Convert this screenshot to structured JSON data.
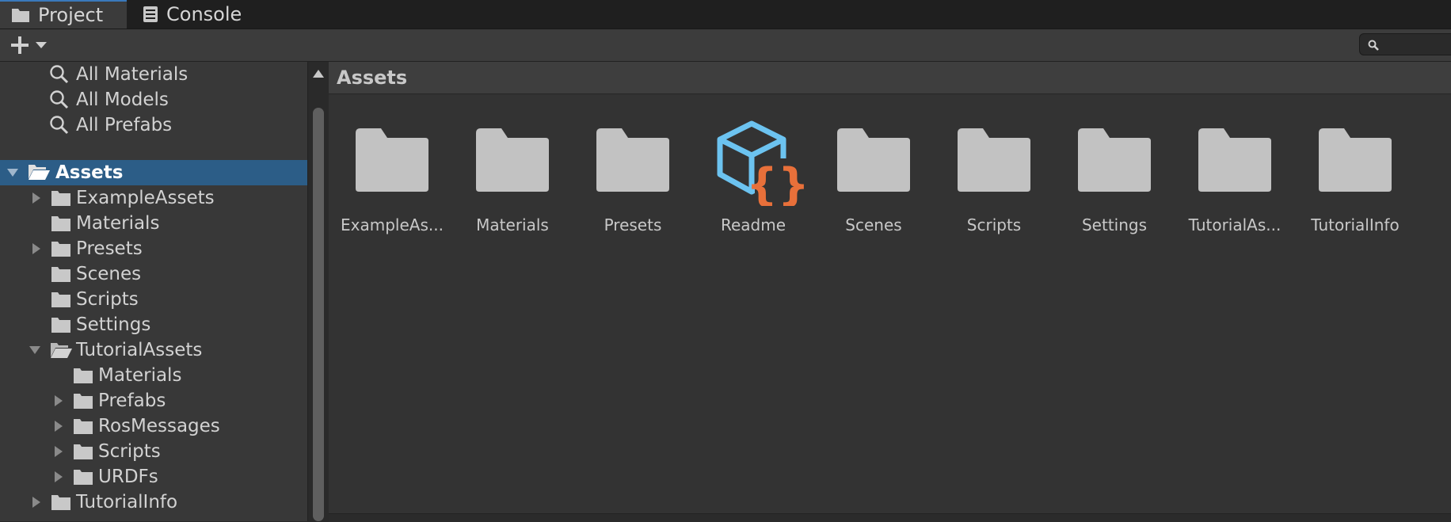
{
  "tabs": [
    {
      "label": "Project",
      "icon": "folder-icon",
      "active": true
    },
    {
      "label": "Console",
      "icon": "console-icon",
      "active": false
    }
  ],
  "toolbar": {
    "add_icon": "plus-icon",
    "dropdown_icon": "chevron-down-icon",
    "search_placeholder": ""
  },
  "sidebar": {
    "items": [
      {
        "label": "All Materials",
        "type": "search-filter",
        "indent": 1
      },
      {
        "label": "All Models",
        "type": "search-filter",
        "indent": 1
      },
      {
        "label": "All Prefabs",
        "type": "search-filter",
        "indent": 1
      },
      {
        "label": "Assets",
        "type": "folder-open",
        "indent": 0,
        "expanded": true,
        "selected": true
      },
      {
        "label": "ExampleAssets",
        "type": "folder",
        "indent": 1,
        "collapsed": true
      },
      {
        "label": "Materials",
        "type": "folder",
        "indent": 1
      },
      {
        "label": "Presets",
        "type": "folder",
        "indent": 1,
        "collapsed": true
      },
      {
        "label": "Scenes",
        "type": "folder",
        "indent": 1
      },
      {
        "label": "Scripts",
        "type": "folder",
        "indent": 1
      },
      {
        "label": "Settings",
        "type": "folder",
        "indent": 1
      },
      {
        "label": "TutorialAssets",
        "type": "folder-open",
        "indent": 1,
        "expanded": true
      },
      {
        "label": "Materials",
        "type": "folder",
        "indent": 2
      },
      {
        "label": "Prefabs",
        "type": "folder",
        "indent": 2,
        "collapsed": true
      },
      {
        "label": "RosMessages",
        "type": "folder",
        "indent": 2,
        "collapsed": true
      },
      {
        "label": "Scripts",
        "type": "folder",
        "indent": 2,
        "collapsed": true
      },
      {
        "label": "URDFs",
        "type": "folder",
        "indent": 2,
        "collapsed": true
      },
      {
        "label": "TutorialInfo",
        "type": "folder",
        "indent": 1,
        "collapsed": true
      }
    ]
  },
  "main": {
    "breadcrumb": "Assets",
    "items": [
      {
        "name": "ExampleAs...",
        "type": "folder"
      },
      {
        "name": "Materials",
        "type": "folder"
      },
      {
        "name": "Presets",
        "type": "folder"
      },
      {
        "name": "Readme",
        "type": "readme"
      },
      {
        "name": "Scenes",
        "type": "folder"
      },
      {
        "name": "Scripts",
        "type": "folder"
      },
      {
        "name": "Settings",
        "type": "folder"
      },
      {
        "name": "TutorialAs...",
        "type": "folder"
      },
      {
        "name": "TutorialInfo",
        "type": "folder"
      }
    ]
  },
  "colors": {
    "selection": "#2c5d87",
    "readme_cube": "#6cc3f0",
    "readme_braces": "#e8703a",
    "folder": "#c2c2c2"
  }
}
